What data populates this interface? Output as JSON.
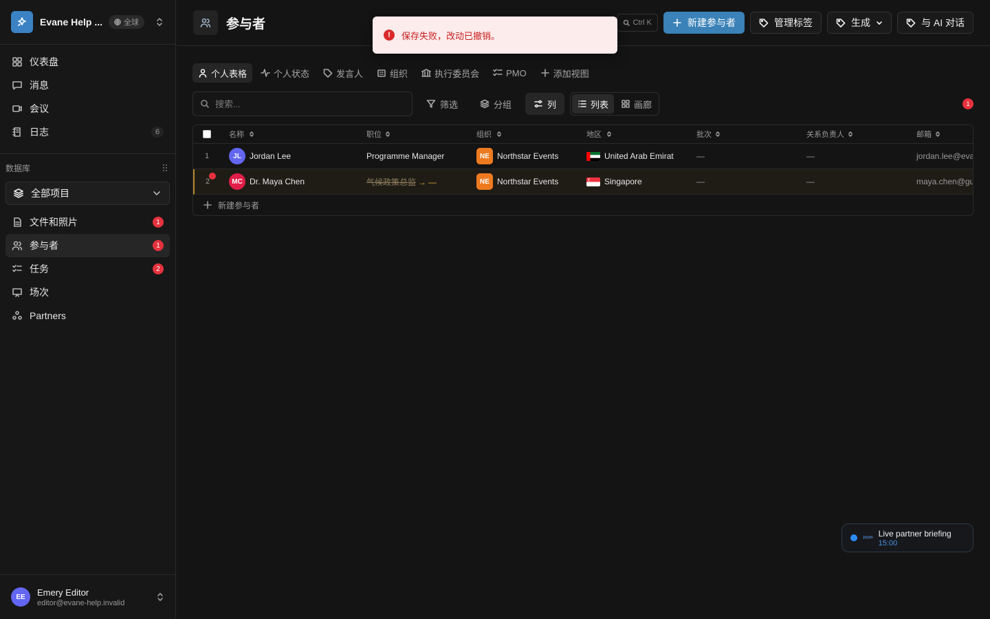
{
  "workspace": {
    "name": "Evane Help ...",
    "scope": "全球"
  },
  "nav": {
    "items": [
      {
        "label": "仪表盘",
        "icon": "dashboard-icon"
      },
      {
        "label": "消息",
        "icon": "message-icon"
      },
      {
        "label": "会议",
        "icon": "video-icon"
      },
      {
        "label": "日志",
        "icon": "log-icon",
        "count": "6"
      }
    ]
  },
  "database": {
    "label": "数据库",
    "selected": "全部项目",
    "items": [
      {
        "label": "文件和照片",
        "badge": "1"
      },
      {
        "label": "参与者",
        "badge": "1"
      },
      {
        "label": "任务",
        "badge": "2"
      },
      {
        "label": "场次"
      },
      {
        "label": "Partners"
      }
    ]
  },
  "user": {
    "initials": "EE",
    "name": "Emery Editor",
    "email": "editor@evane-help.invalid"
  },
  "header": {
    "title": "参与者",
    "shortcut": "Ctrl K",
    "new_button": "新建参与者",
    "manage_tags": "管理标签",
    "generate": "生成",
    "ai_chat": "与 AI 对话"
  },
  "toast": {
    "message": "保存失败，改动已撤销。"
  },
  "views": {
    "tabs": [
      "个人表格",
      "个人状态",
      "发言人",
      "组织",
      "执行委员会",
      "PMO",
      "添加视图"
    ]
  },
  "toolbar": {
    "search_placeholder": "搜索...",
    "filter": "筛选",
    "group": "分组",
    "columns": "列",
    "list": "列表",
    "gallery": "画廊",
    "notifications": "1"
  },
  "table": {
    "headers": [
      "名称",
      "职位",
      "组织",
      "地区",
      "批次",
      "关系负责人",
      "邮箱"
    ],
    "rows": [
      {
        "index": "1",
        "initials": "JL",
        "avatar_color": "#6366f1",
        "name": "Jordan Lee",
        "title": "Programme Manager",
        "org_initials": "NE",
        "org": "Northstar Events",
        "region": "United Arab Emirat",
        "batch": "—",
        "owner": "—",
        "email": "jordan.lee@evane"
      },
      {
        "index": "2",
        "initials": "MC",
        "avatar_color": "#e11d48",
        "name": "Dr. Maya Chen",
        "title_old": "气候政策总监",
        "title_arrow": "→",
        "title_new": "—",
        "org_initials": "NE",
        "org": "Northstar Events",
        "region": "Singapore",
        "batch": "—",
        "owner": "—",
        "email": "maya.chen@gulf"
      }
    ],
    "add_row": "新建参与者"
  },
  "meeting": {
    "logo": "zoom",
    "title": "Live partner briefing",
    "time": "15:00"
  }
}
